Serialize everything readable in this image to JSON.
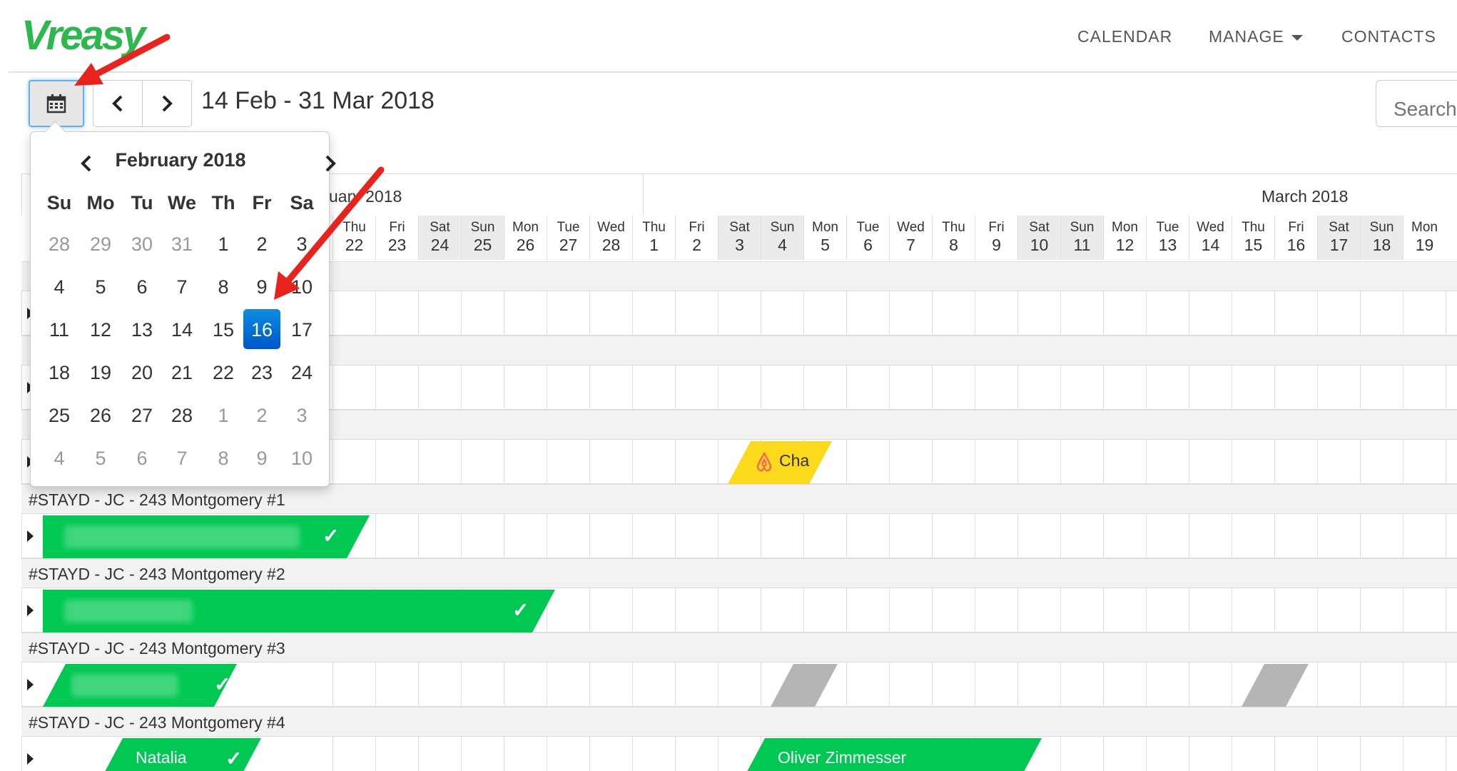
{
  "brand": {
    "logo_text": "Vreasy",
    "accent": "#2db84d"
  },
  "nav": {
    "calendar": "CALENDAR",
    "manage": "MANAGE",
    "contacts": "CONTACTS"
  },
  "toolbar": {
    "calendar_icon": "calendar-icon",
    "prev_icon": "chevron-left-icon",
    "next_icon": "chevron-right-icon",
    "date_range": "14 Feb - 31 Mar 2018",
    "search_placeholder": "Search"
  },
  "scheduler": {
    "months": {
      "feb": "uary 2018",
      "mar": "March 2018"
    },
    "days": [
      {
        "dow": "Thu",
        "d": "22"
      },
      {
        "dow": "Fri",
        "d": "23"
      },
      {
        "dow": "Sat",
        "d": "24"
      },
      {
        "dow": "Sun",
        "d": "25"
      },
      {
        "dow": "Mon",
        "d": "26"
      },
      {
        "dow": "Tue",
        "d": "27"
      },
      {
        "dow": "Wed",
        "d": "28"
      },
      {
        "dow": "Thu",
        "d": "1"
      },
      {
        "dow": "Fri",
        "d": "2"
      },
      {
        "dow": "Sat",
        "d": "3"
      },
      {
        "dow": "Sun",
        "d": "4"
      },
      {
        "dow": "Mon",
        "d": "5"
      },
      {
        "dow": "Tue",
        "d": "6"
      },
      {
        "dow": "Wed",
        "d": "7"
      },
      {
        "dow": "Thu",
        "d": "8"
      },
      {
        "dow": "Fri",
        "d": "9"
      },
      {
        "dow": "Sat",
        "d": "10"
      },
      {
        "dow": "Sun",
        "d": "11"
      },
      {
        "dow": "Mon",
        "d": "12"
      },
      {
        "dow": "Tue",
        "d": "13"
      },
      {
        "dow": "Wed",
        "d": "14"
      },
      {
        "dow": "Thu",
        "d": "15"
      },
      {
        "dow": "Fri",
        "d": "16"
      },
      {
        "dow": "Sat",
        "d": "17"
      },
      {
        "dow": "Sun",
        "d": "18"
      },
      {
        "dow": "Mon",
        "d": "19"
      }
    ],
    "groups": [
      "#STAYD - JC - 243 Montgomery #1",
      "#STAYD - JC - 243 Montgomery #2",
      "#STAYD - JC - 243 Montgomery #3",
      "#STAYD - JC - 243 Montgomery #4"
    ],
    "booking_labels": {
      "cha": "Cha",
      "natalia": "Natalia",
      "oliver": "Oliver Zimmesser"
    },
    "colors": {
      "confirmed": "#00c853",
      "pending": "#fbd91b",
      "blocked": "#b5b5b5",
      "airbnb": "#ff5a5f"
    }
  },
  "datepicker": {
    "title": "February 2018",
    "dow": [
      "Su",
      "Mo",
      "Tu",
      "We",
      "Th",
      "Fr",
      "Sa"
    ],
    "weeks": [
      [
        "28",
        "29",
        "30",
        "31",
        "1",
        "2",
        "3"
      ],
      [
        "4",
        "5",
        "6",
        "7",
        "8",
        "9",
        "10"
      ],
      [
        "11",
        "12",
        "13",
        "14",
        "15",
        "16",
        "17"
      ],
      [
        "18",
        "19",
        "20",
        "21",
        "22",
        "23",
        "24"
      ],
      [
        "25",
        "26",
        "27",
        "28",
        "1",
        "2",
        "3"
      ],
      [
        "4",
        "5",
        "6",
        "7",
        "8",
        "9",
        "10"
      ]
    ],
    "selected": "16",
    "selected_color": "#0a6fd6"
  }
}
